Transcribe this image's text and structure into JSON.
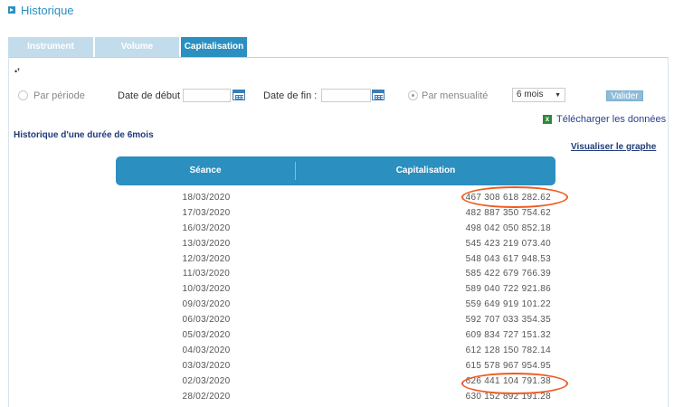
{
  "header": {
    "title": "Historique"
  },
  "tabs": [
    {
      "label": "Instrument",
      "active": false
    },
    {
      "label": "Volume",
      "active": false
    },
    {
      "label": "Capitalisation",
      "active": true
    }
  ],
  "filters": {
    "radio_period_label": "Par période",
    "date_start_label": "Date de début :",
    "date_start_value": "",
    "date_end_label": "Date de fin :",
    "date_end_value": "",
    "radio_monthly_label": "Par mensualité",
    "monthly_selected": "6 mois",
    "validate_label": "Valider"
  },
  "download_label": "Télécharger les données",
  "subtitle": "Historique d'une durée de 6mois",
  "graph_link": "Visualiser le graphe",
  "table": {
    "headers": [
      "Séance",
      "Capitalisation"
    ],
    "rows": [
      {
        "date": "18/03/2020",
        "value": "467 308 618 282.62"
      },
      {
        "date": "17/03/2020",
        "value": "482 887 350 754.62"
      },
      {
        "date": "16/03/2020",
        "value": "498 042 050 852.18"
      },
      {
        "date": "13/03/2020",
        "value": "545 423 219 073.40"
      },
      {
        "date": "12/03/2020",
        "value": "548 043 617 948.53"
      },
      {
        "date": "11/03/2020",
        "value": "585 422 679 766.39"
      },
      {
        "date": "10/03/2020",
        "value": "589 040 722 921.86"
      },
      {
        "date": "09/03/2020",
        "value": "559 649 919 101.22"
      },
      {
        "date": "06/03/2020",
        "value": "592 707 033 354.35"
      },
      {
        "date": "05/03/2020",
        "value": "609 834 727 151.32"
      },
      {
        "date": "04/03/2020",
        "value": "612 128 150 782.14"
      },
      {
        "date": "03/03/2020",
        "value": "615 578 967 954.95"
      },
      {
        "date": "02/03/2020",
        "value": "626 441 104 791.38"
      },
      {
        "date": "28/02/2020",
        "value": "630 152 892 191.28"
      }
    ]
  },
  "colors": {
    "accent": "#2b8fc0",
    "highlight": "#f05a22",
    "link": "#1f3b7a"
  }
}
